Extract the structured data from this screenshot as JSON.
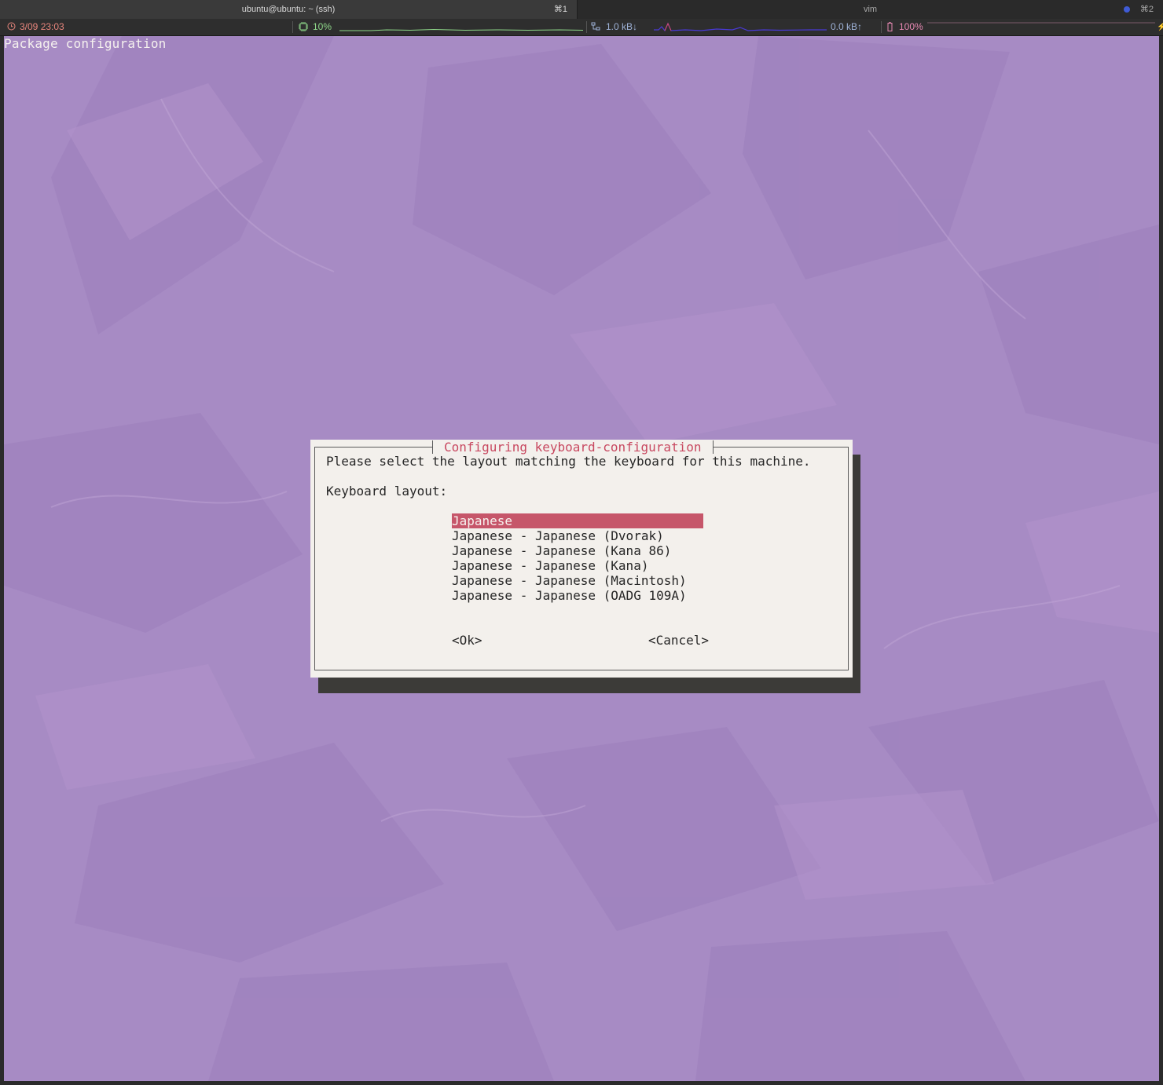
{
  "tabs": [
    {
      "title": "ubuntu@ubuntu: ~ (ssh)",
      "shortcut": "⌘1",
      "active": true
    },
    {
      "title": "vim",
      "shortcut": "⌘2",
      "active": false,
      "dot_color": "#3f5bd6"
    }
  ],
  "status": {
    "datetime": "3/09 23:03",
    "cpu": "10%",
    "net_down": "1.0 kB↓",
    "net_up": "0.0 kB↑",
    "battery": "100%",
    "colors": {
      "clock": "#e8867d",
      "cpu": "#8fd88a",
      "net": "#9fb3d8",
      "battery": "#e889b4"
    }
  },
  "terminal": {
    "header": "Package configuration",
    "background": "#a78bc4"
  },
  "dialog": {
    "title": "Configuring keyboard-configuration",
    "prompt": "Please select the layout matching the keyboard for this machine.",
    "label": "Keyboard layout:",
    "options": [
      "Japanese",
      "Japanese - Japanese (Dvorak)",
      "Japanese - Japanese (Kana 86)",
      "Japanese - Japanese (Kana)",
      "Japanese - Japanese (Macintosh)",
      "Japanese - Japanese (OADG 109A)"
    ],
    "selected_index": 0,
    "ok_label": "<Ok>",
    "cancel_label": "<Cancel>",
    "accent": "#c6566a"
  }
}
